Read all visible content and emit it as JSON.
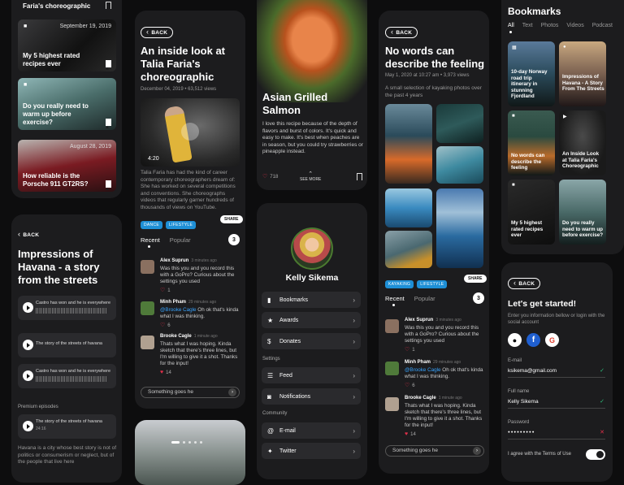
{
  "col1": {
    "top_title": "Faria's choreographic",
    "items": [
      {
        "date": "September 19, 2019",
        "title": "My 5 highest rated recipes ever"
      },
      {
        "date": "",
        "title": "Do you really need to warm up before exercise?"
      },
      {
        "date": "August 28, 2019",
        "title": "How reliable is the Porsche 911 GT2RS?"
      }
    ]
  },
  "havana": {
    "back": "BACK",
    "title": "Impressions of Havana - a story from the streets",
    "tracks": [
      {
        "name": "Castro has won and he is everywhere",
        "time": "24:16"
      },
      {
        "name": "The story of the streets of havana",
        "time": ""
      },
      {
        "name": "Castro has won and he is everywhere",
        "time": "24:16"
      }
    ],
    "premium_label": "Premium episodes",
    "premium_track": {
      "name": "The story of the streets of havana",
      "time": "24:16"
    },
    "desc": "Havana is a city whose best story is not of politics or consumerism or neglect, but of the people that live here"
  },
  "article": {
    "back": "BACK",
    "title": "An inside look at Talia Faria's choreographic",
    "meta": "December 04, 2019 • 63,512 views",
    "duration": "4:20",
    "body": "Talia Faria has had the kind of career contemporary choreographers dream of: She has worked on several competitions and conventions. She choreographs videos that regularly garner hundreds of thousands of views on YouTube.",
    "tags": [
      "DANCE",
      "LIFESTYLE"
    ],
    "share": "SHARE",
    "tabs": [
      "Recent",
      "Popular"
    ],
    "count": "3",
    "comments": [
      {
        "name": "Alex Suprun",
        "time": "3 minutes ago",
        "text": "Was this you and you record this with a GoPro? Curious about the settings you used",
        "likes": "1"
      },
      {
        "name": "Minh Pham",
        "time": "29 minutes ago",
        "mention": "@Brooke Cagle",
        "text": " Oh ok that's kinda what I was thinking.",
        "likes": "6"
      },
      {
        "name": "Brooke Cagle",
        "time": "1 minute ago",
        "text": "Thats what I was hoping. Kinda sketch that there's three lines, but I'm willing to give it a shot. Thanks for the input!",
        "likes": "14"
      }
    ],
    "input": "Something goes he"
  },
  "recipe": {
    "title": "Asian Grilled Salmon",
    "body": "I love this recipe because of the depth of flavors and burst of colors. It's quick and easy to make. It's best when peaches are in season, but you could try strawberries or pineapple instead.",
    "likes": "718",
    "see_more": "SEE MORE"
  },
  "profile": {
    "name": "Kelly Sikema",
    "menu1": [
      "Bookmarks",
      "Awards",
      "Donates"
    ],
    "settings_label": "Settings",
    "menu2": [
      "Feed",
      "Notifications"
    ],
    "community_label": "Community",
    "menu3": [
      "E-mail",
      "Twitter"
    ]
  },
  "kayak": {
    "back": "BACK",
    "title": "No words can describe the feeling",
    "meta": "May 1, 2020 at 10:27 am • 3,973 views",
    "body": "A small selection of kayaking photos over the past 4 years",
    "tags": [
      "KAYAKING",
      "LIFESTYLE"
    ],
    "share": "SHARE",
    "tabs": [
      "Recent",
      "Popular"
    ],
    "count": "3",
    "comments": [
      {
        "name": "Alex Suprun",
        "time": "3 minutes ago",
        "text": "Was this you and you record this with a GoPro? Curious about the settings you used",
        "likes": "1"
      },
      {
        "name": "Minh Pham",
        "time": "29 minutes ago",
        "mention": "@Brooke Cagle",
        "text": " Oh ok that's kinda what I was thinking.",
        "likes": "6"
      },
      {
        "name": "Brooke Cagle",
        "time": "1 minute ago",
        "text": "Thats what I was hoping. Kinda sketch that there's three lines, but I'm willing to give it a shot. Thanks for the input!",
        "likes": "14"
      }
    ],
    "input": "Something goes he"
  },
  "bookmarks": {
    "title": "Bookmarks",
    "filters": [
      "All",
      "Text",
      "Photos",
      "Videos",
      "Podcast"
    ],
    "items": [
      "10-day Norway road trip itinerary in stunning Fjordland",
      "Impressions of Havana - A Story From The Streets",
      "No words can describe the feeling",
      "An Inside Look at Talia Faria's Choreographic",
      "My 5 highest rated recipes ever",
      "Do you really need to warm up before exercise?"
    ]
  },
  "signup": {
    "back": "BACK",
    "title": "Let's get started!",
    "sub": "Enter you information bellow or login with the social account",
    "email_label": "E-mail",
    "email": "ksikema@gmail.com",
    "name_label": "Full name",
    "name": "Kelly Sikema",
    "pass_label": "Password",
    "pass": "●●●●●●●●●",
    "terms": "I agree with the Terms of Use"
  },
  "colors": {
    "accent": "#1e8fd6",
    "bg": "#1c1c1e",
    "like": "#e0304a"
  }
}
